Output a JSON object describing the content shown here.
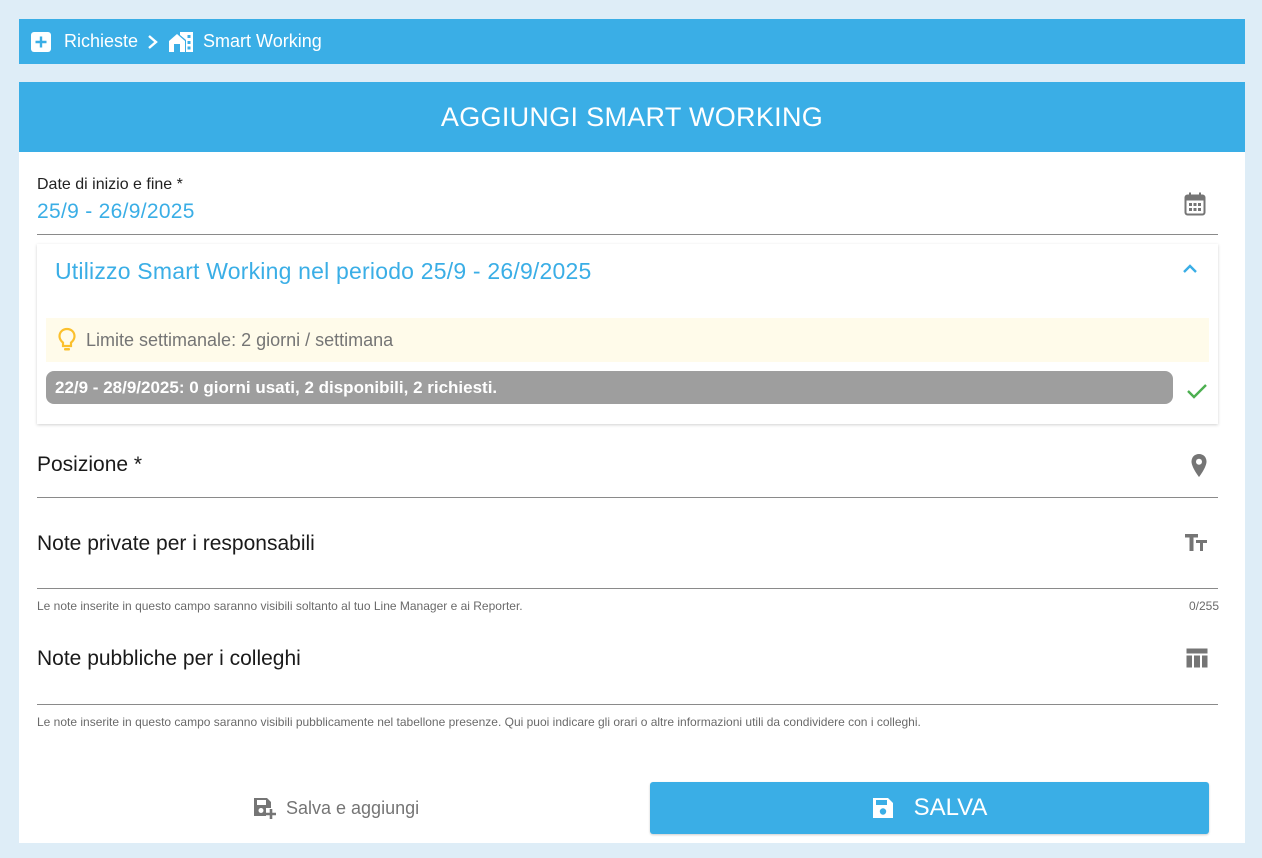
{
  "breadcrumb": {
    "items": [
      "Richieste",
      "Smart Working"
    ]
  },
  "header": {
    "title": "AGGIUNGI SMART WORKING"
  },
  "dates": {
    "label": "Date di inizio e fine  *",
    "value": "25/9 - 26/9/2025"
  },
  "usage": {
    "title": "Utilizzo Smart Working nel periodo 25/9 - 26/9/2025",
    "tip": "Limite settimanale: 2 giorni / settimana",
    "week": "22/9 - 28/9/2025: 0 giorni usati, 2 disponibili, 2 richiesti."
  },
  "position": {
    "label": "Posizione  *"
  },
  "private_notes": {
    "label": "Note private per i responsabili",
    "hint": "Le note inserite in questo campo saranno visibili soltanto al tuo Line Manager e ai Reporter.",
    "counter": "0/255"
  },
  "public_notes": {
    "label": "Note pubbliche per i colleghi",
    "hint": "Le note inserite in questo campo saranno visibili pubblicamente nel tabellone presenze. Qui puoi indicare gli orari o altre informazioni utili da condividere con i colleghi."
  },
  "actions": {
    "save_and_add": "Salva e aggiungi",
    "save": "SALVA"
  },
  "colors": {
    "accent": "#3aaee6",
    "background": "#deedf7",
    "tip_bg": "#fffbea",
    "week_bg": "#9e9e9e",
    "success": "#4caf50",
    "bulb": "#fbc02d"
  }
}
